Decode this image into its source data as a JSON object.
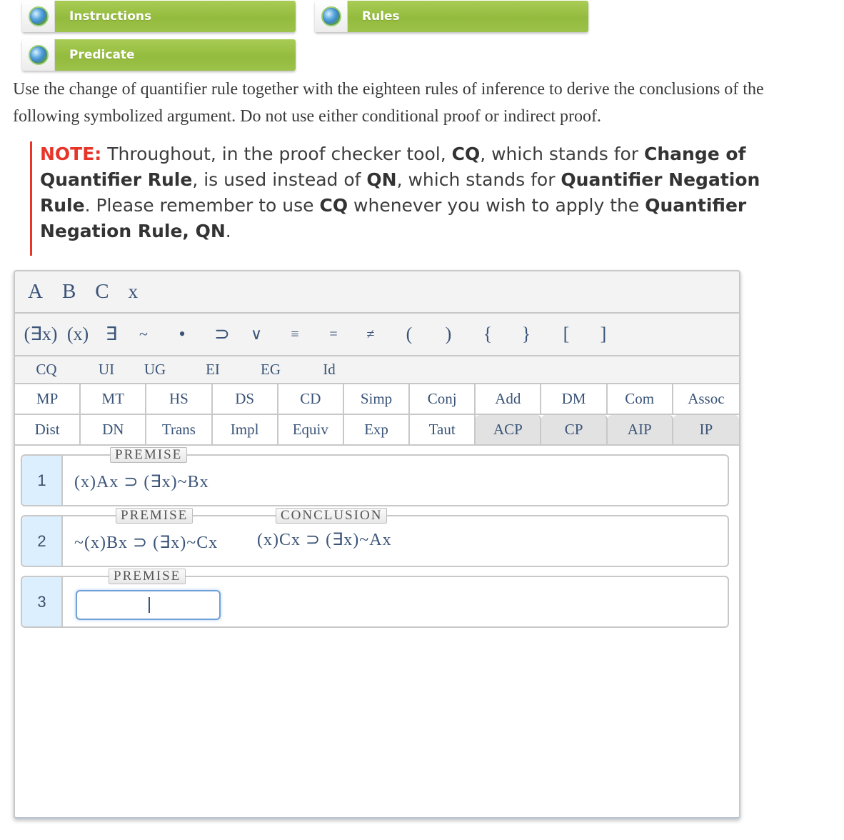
{
  "tabs": [
    {
      "label": "Instructions",
      "icon": "globe-icon"
    },
    {
      "label": "Rules",
      "icon": "globe-icon"
    },
    {
      "label": "Predicate",
      "icon": "globe-icon"
    }
  ],
  "instructions": "Use the change of quantifier rule together with the eighteen rules of inference to derive the conclusions of the following symbolized argument. Do not use either conditional proof or indirect proof.",
  "note": {
    "label": "NOTE:",
    "t1": " Throughout, in the proof checker tool, ",
    "b1": "CQ",
    "t2": ", which stands for ",
    "b2": "Change of Quantifier Rule",
    "t3": ", is used instead of ",
    "b3": "QN",
    "t4": ", which stands for ",
    "b4": "Quantifier Negation Rule",
    "t5": ". Please remember to use ",
    "b5": "CQ",
    "t6": " whenever you wish to apply the ",
    "b6": "Quantifier Negation Rule, QN",
    "t7": "."
  },
  "checker": {
    "letters": [
      "A",
      "B",
      "C",
      "x"
    ],
    "operators": [
      "(∃x)",
      "(x)",
      "∃",
      "~",
      "•",
      "⊃",
      "∨",
      "≡",
      "=",
      "≠",
      "(",
      ")",
      "{",
      "}",
      "[",
      "]"
    ],
    "quantifier_rules": [
      "CQ",
      "UI",
      "UG",
      "EI",
      "EG",
      "Id"
    ],
    "rules_row1": [
      "MP",
      "MT",
      "HS",
      "DS",
      "CD",
      "Simp",
      "Conj",
      "Add",
      "DM",
      "Com",
      "Assoc"
    ],
    "rules_row2": [
      "Dist",
      "DN",
      "Trans",
      "Impl",
      "Equiv",
      "Exp",
      "Taut",
      "ACP",
      "CP",
      "AIP",
      "IP"
    ],
    "lines": [
      {
        "number": "1",
        "tag": "PREMISE",
        "formula": "(x)Ax ⊃ (∃x)~Bx"
      },
      {
        "number": "2",
        "tag": "PREMISE",
        "formula": "~(x)Bx ⊃ (∃x)~Cx",
        "conclusion_tag": "CONCLUSION",
        "conclusion": "(x)Cx ⊃ (∃x)~Ax"
      },
      {
        "number": "3",
        "tag": "PREMISE",
        "input_value": ""
      }
    ]
  }
}
